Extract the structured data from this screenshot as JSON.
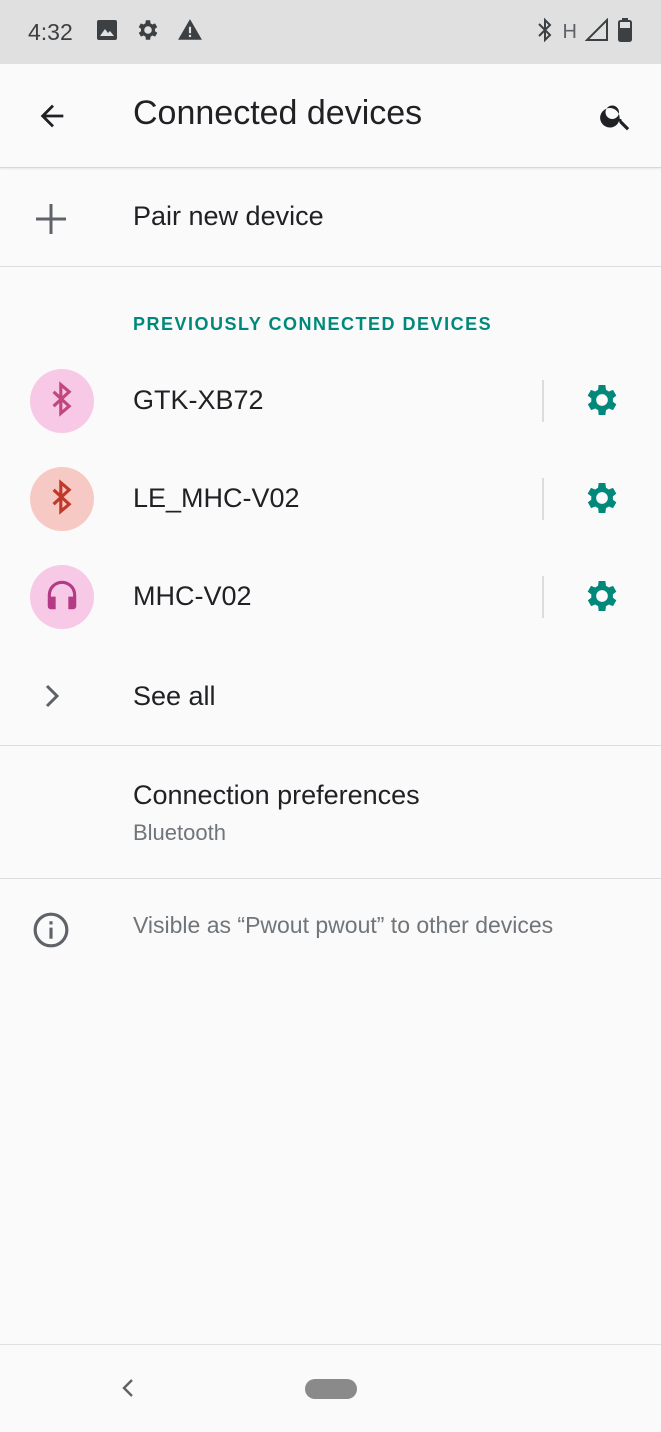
{
  "status_bar": {
    "time": "4:32",
    "left_icons": [
      "image-icon",
      "gear-icon",
      "warning-icon"
    ],
    "network_type": "H",
    "right_icons": [
      "bluetooth-icon",
      "signal-icon",
      "battery-icon"
    ]
  },
  "app_bar": {
    "title": "Connected devices",
    "back_icon": "arrow-back-icon",
    "search_icon": "search-icon"
  },
  "pair_new_device": {
    "label": "Pair new device",
    "icon": "plus-icon"
  },
  "previously_connected": {
    "header": "PREVIOUSLY CONNECTED DEVICES",
    "devices": [
      {
        "name": "GTK-XB72",
        "icon": "bluetooth-icon",
        "avatar_color": "#f8c9e6",
        "icon_color": "#c2477d"
      },
      {
        "name": "LE_MHC-V02",
        "icon": "bluetooth-icon",
        "avatar_color": "#f7c9c4",
        "icon_color": "#c0392b"
      },
      {
        "name": "MHC-V02",
        "icon": "headphones-icon",
        "avatar_color": "#f8c9e6",
        "icon_color": "#b43a86"
      }
    ],
    "settings_icon": "gear-icon",
    "settings_color": "#00897b"
  },
  "see_all": {
    "label": "See all",
    "icon": "chevron-right-icon"
  },
  "connection_preferences": {
    "title": "Connection preferences",
    "subtitle": "Bluetooth"
  },
  "visibility_info": {
    "text": "Visible as “Pwout pwout” to other devices",
    "icon": "info-icon"
  },
  "nav_bar": {
    "back_icon": "nav-back-icon",
    "home_icon": "home-pill-icon"
  },
  "colors": {
    "accent": "#00897b",
    "background": "#fafafa",
    "status_bar": "#e0e0e0"
  }
}
